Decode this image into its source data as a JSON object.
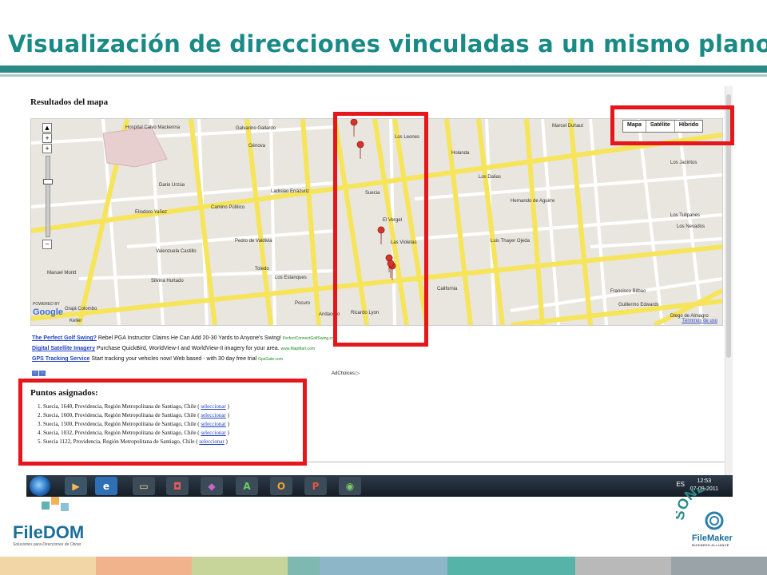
{
  "slide": {
    "title": "Visualización de direcciones vinculadas a un mismo plano."
  },
  "browser": {
    "section_title": "Resultados del mapa",
    "map": {
      "type_buttons": [
        "Mapa",
        "Satélite",
        "Híbrido"
      ],
      "selected_type": "Mapa",
      "powered_by": "POWERED BY",
      "google": "Google",
      "terms": "Términos de uso",
      "street_labels": [
        "Galvarino Gallardo",
        "Génova",
        "Eliodoro Yañez",
        "Dario Urzúa",
        "Ladislao Errázuriz",
        "Camino Público",
        "Valenzuela Castillo",
        "Manuel Montt",
        "Silvina Hurtado",
        "Toledo",
        "Los Estanques",
        "Pocuro",
        "Francisco Bilbao",
        "Guillermo Edwards",
        "Keller",
        "Grajá Colombo",
        "Hospital Calvo Mackenna",
        "Las Violetas",
        "Los Leones",
        "Suecia",
        "Ricardo Lyon",
        "El Vergel",
        "Los Dalias",
        "Hernando de Aguirre",
        "Marcel Duhaut",
        "Los Jacintos",
        "Los Tulipanes",
        "Los Nevados",
        "Diego de Almagro",
        "Luis Thayer Ojeda",
        "California",
        "Andacollo",
        "Pedro de Valdivia",
        "Holanda"
      ],
      "markers": 6
    },
    "ads": [
      {
        "link": "The Perfect Golf Swing?",
        "text": "Rebel PGA Instructor Claims He Can Add 20-30 Yards to Anyone's Swing!",
        "url": "PerfectConnectGolfSwing.co"
      },
      {
        "link": "Digital Satellite Imagery",
        "text": "Purchase QuickBird, WorldView-I and WorldView-II imagery for your area.",
        "url": "www.MapMart.com"
      },
      {
        "link": "GPS Tracking Service",
        "text": "Start tracking your vehicles now! Web based - with 30 day free trial",
        "url": "GpsGate.com"
      }
    ],
    "ad_choices": "AdChoices ▷",
    "puntos": {
      "title": "Puntos asignados:",
      "select_label": "seleccionar",
      "items": [
        {
          "pre": "Suecia, 1640, Providencia, Región Metropolitana de Santiago, Chile ( ",
          "post": " )"
        },
        {
          "pre": "Suecia, 1600, Providencia, Región Metropolitana de Santiago, Chile ( ",
          "post": " )"
        },
        {
          "pre": "Suecia, 1500, Providencia, Región Metropolitana de Santiago, Chile ( ",
          "post": " )"
        },
        {
          "pre": "Suecia, 1032, Providencia, Región Metropolitana de Santiago, Chile ( ",
          "post": " )"
        },
        {
          "pre": "Suecia 1122, Providencia, Región Metropolitana de Santiago, Chile ( ",
          "post": " )"
        }
      ]
    }
  },
  "taskbar": {
    "language": "ES",
    "time": "12:53",
    "date": "07-09-2011"
  },
  "branding": {
    "filedom": "FileDOM",
    "filedom_tagline": "Soluciones para Direcciones de Obras",
    "sonet": "SONET",
    "filemaker": "FileMaker",
    "business_alliance": "BUSINESS ALLIANCE"
  },
  "colors": {
    "title": "#1a8a86",
    "highlight": "#e5161c",
    "road_major": "#f6e45a",
    "road_minor": "#ffffff",
    "map_bg": "#e9e6df",
    "footer": [
      "#f2d6a6",
      "#f0b38c",
      "#c8d59a",
      "#7fb7b1",
      "#8db7c9",
      "#56b3a8",
      "#b9b9b9",
      "#9aa3a8"
    ]
  }
}
